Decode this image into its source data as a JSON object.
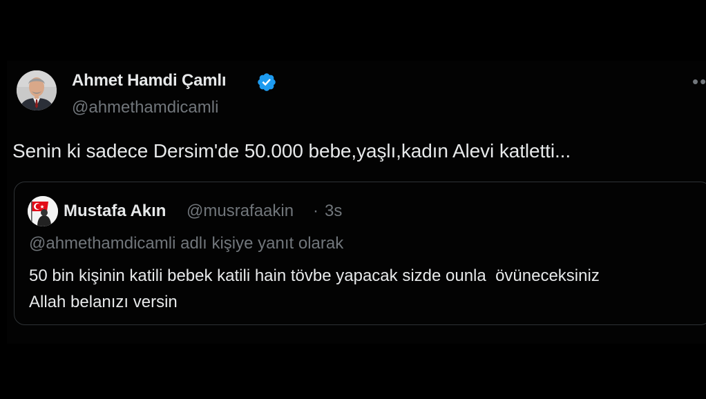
{
  "tweet": {
    "author": {
      "display_name": "Ahmet Hamdi Çamlı",
      "handle": "@ahmethamdicamli",
      "verified": true,
      "avatar_icon": "profile-photo"
    },
    "more_icon": "more-horizontal-icon",
    "text": "Senin ki sadece Dersim'de 50.000 bebe,yaşlı,kadın Alevi katletti..."
  },
  "quote": {
    "author": {
      "display_name": "Mustafa Akın",
      "handle": "@musrafaakin",
      "separator": "·",
      "time": "3s",
      "avatar_icon": "turkish-flag-avatar"
    },
    "reply_to": "@ahmethamdicamli adlı kişiye yanıt olarak",
    "text": "50 bin kişinin katili bebek katili hain tövbe yapacak sizde ounla  övüneceksiniz\nAllah belanızı versin"
  },
  "colors": {
    "background": "#000000",
    "text_primary": "#e7e9ea",
    "text_secondary": "#71767b",
    "border": "#2f3336",
    "verified_blue": "#1d9bf0",
    "flag_red": "#e30a17"
  }
}
